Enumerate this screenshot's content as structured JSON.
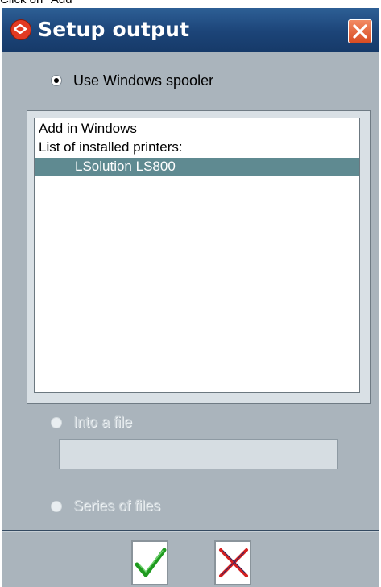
{
  "caption": "Click on \"Add\"",
  "window": {
    "title": "Setup output",
    "icons": {
      "app": "app-logo-icon",
      "close": "close-icon"
    }
  },
  "spooler": {
    "label": "Use Windows spooler",
    "selected": true
  },
  "printer_list": {
    "lines": [
      "Add in Windows",
      "List of installed printers:"
    ],
    "selected_item": "LSolution LS800"
  },
  "into_file": {
    "label": "Into a file",
    "enabled": false,
    "value": ""
  },
  "series_files": {
    "label": "Series of files",
    "enabled": false
  },
  "buttons": {
    "ok": {
      "icon": "checkmark-icon",
      "color": "#1f9a1f"
    },
    "cancel": {
      "icon": "cross-icon",
      "color": "#d41f1f"
    }
  },
  "colors": {
    "titlebar": "#1c4478",
    "window_bg": "#aab4bc",
    "selection": "#5f8a91",
    "close": "#e06436"
  }
}
